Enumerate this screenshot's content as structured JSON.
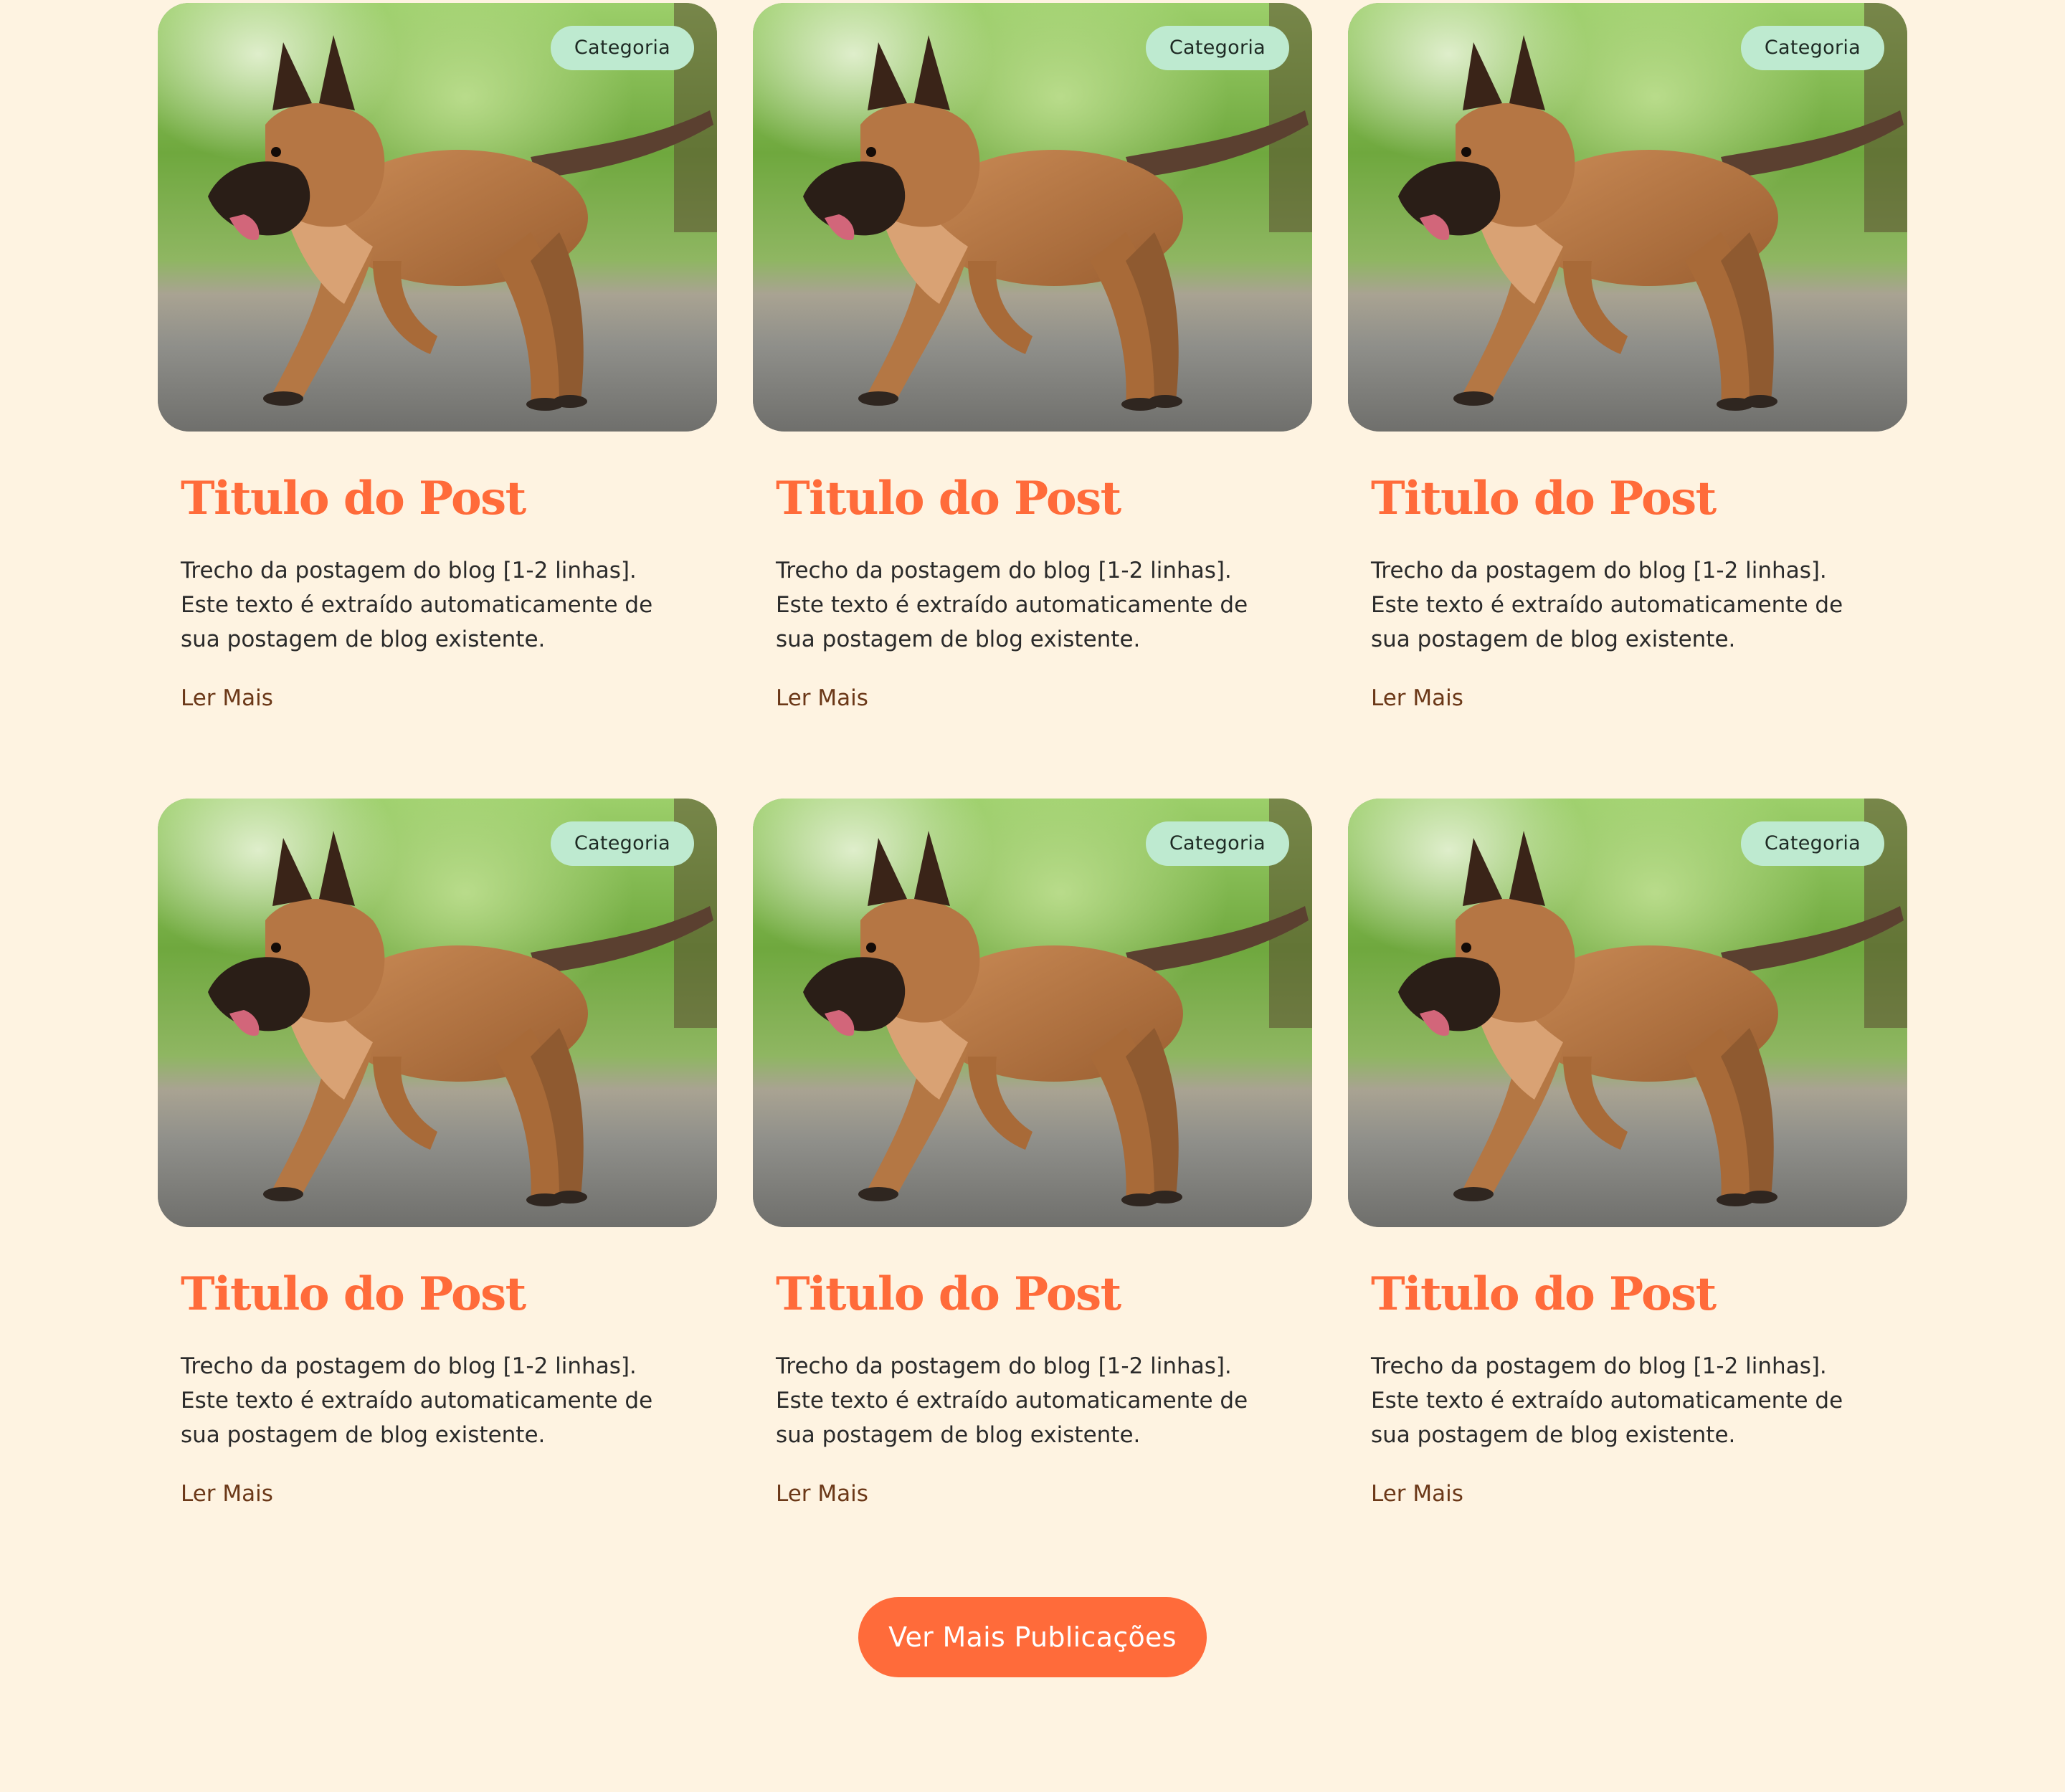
{
  "posts": [
    {
      "category": "Categoria",
      "title": "Titulo do Post",
      "excerpt": "Trecho da postagem do blog [1-2 linhas]. Este texto é extraído automaticamente de sua postagem de blog existente.",
      "read_more": "Ler Mais"
    },
    {
      "category": "Categoria",
      "title": "Titulo do Post",
      "excerpt": "Trecho da postagem do blog [1-2 linhas]. Este texto é extraído automaticamente de sua postagem de blog existente.",
      "read_more": "Ler Mais"
    },
    {
      "category": "Categoria",
      "title": "Titulo do Post",
      "excerpt": "Trecho da postagem do blog [1-2 linhas]. Este texto é extraído automaticamente de sua postagem de blog existente.",
      "read_more": "Ler Mais"
    },
    {
      "category": "Categoria",
      "title": "Titulo do Post",
      "excerpt": "Trecho da postagem do blog [1-2 linhas]. Este texto é extraído automaticamente de sua postagem de blog existente.",
      "read_more": "Ler Mais"
    },
    {
      "category": "Categoria",
      "title": "Titulo do Post",
      "excerpt": "Trecho da postagem do blog [1-2 linhas]. Este texto é extraído automaticamente de sua postagem de blog existente.",
      "read_more": "Ler Mais"
    },
    {
      "category": "Categoria",
      "title": "Titulo do Post",
      "excerpt": "Trecho da postagem do blog [1-2 linhas]. Este texto é extraído automaticamente de sua postagem de blog existente.",
      "read_more": "Ler Mais"
    }
  ],
  "load_more_label": "Ver Mais Publicações",
  "colors": {
    "background": "#FEF3E1",
    "accent": "#FF6B3A",
    "badge": "#BEEAD0",
    "link": "#6B3818",
    "text": "#2A2A2A"
  }
}
